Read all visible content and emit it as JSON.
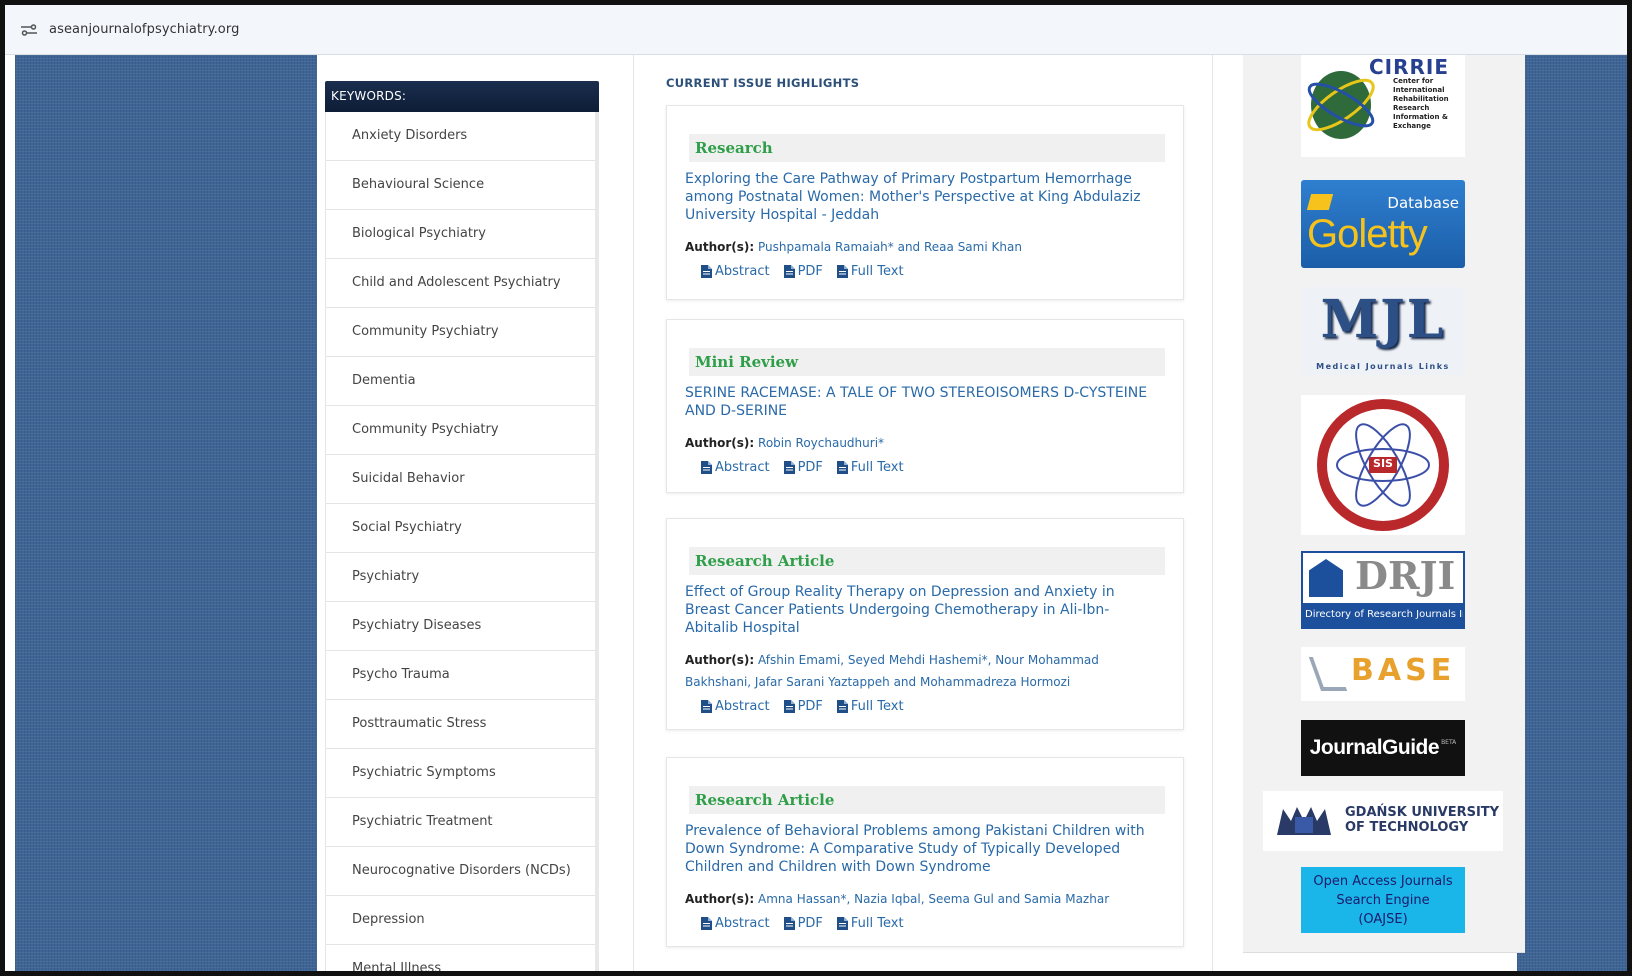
{
  "browser": {
    "url": "aseanjournalofpsychiatry.org"
  },
  "keywords": {
    "header": "KEYWORDS:",
    "items": [
      "Anxiety Disorders",
      "Behavioural Science",
      "Biological Psychiatry",
      "Child and Adolescent Psychiatry",
      "Community Psychiatry",
      "Dementia",
      "Community Psychiatry",
      "Suicidal Behavior",
      "Social Psychiatry",
      "Psychiatry",
      "Psychiatry Diseases",
      "Psycho Trauma",
      "Posttraumatic Stress",
      "Psychiatric Symptoms",
      "Psychiatric Treatment",
      "Neurocognative Disorders (NCDs)",
      "Depression",
      "Mental Illness"
    ]
  },
  "highlights": {
    "title": "CURRENT ISSUE HIGHLIGHTS",
    "author_label": "Author(s):",
    "links": {
      "abstract": "Abstract",
      "pdf": "PDF",
      "fulltext": "Full Text"
    },
    "articles": [
      {
        "type": "Research",
        "title": "Exploring the Care Pathway of Primary Postpartum Hemorrhage among Postnatal Women: Mother's Perspective at King Abdulaziz University Hospital - Jeddah",
        "authors": "Pushpamala Ramaiah* and Reaa Sami Khan"
      },
      {
        "type": "Mini Review",
        "title": "SERINE RACEMASE: A TALE OF TWO STEREOISOMERS D-CYSTEINE AND D-SERINE",
        "authors": "Robin Roychaudhuri*"
      },
      {
        "type": "Research Article",
        "title": "Effect of Group Reality Therapy on Depression and Anxiety in Breast Cancer Patients Undergoing Chemotherapy in Ali-Ibn-Abitalib Hospital",
        "authors": "Afshin Emami, Seyed Mehdi Hashemi*, Nour Mohammad Bakhshani, Jafar Sarani Yaztappeh and Mohammadreza Hormozi"
      },
      {
        "type": "Research Article",
        "title": "Prevalence of Behavioral Problems among Pakistani Children with Down Syndrome: A Comparative Study of Typically Developed Children and Children with Down Syndrome",
        "authors": "Amna Hassan*, Nazia Iqbal, Seema Gul and Samia Mazhar"
      }
    ]
  },
  "logos": {
    "cirrie": {
      "name": "CIRRIE",
      "lines": [
        "Center for",
        "International",
        "Rehabilitation",
        "Research",
        "Information &",
        "Exchange"
      ]
    },
    "goletty": {
      "top": "Database",
      "word": "Goletty"
    },
    "mjl": {
      "word": "MJL",
      "sub": "Medical Journals Links"
    },
    "sis": {
      "text": "SIS"
    },
    "drji": {
      "word": "DRJI",
      "sub": "Directory of Research Journals Indexing"
    },
    "base": {
      "word": "BASE"
    },
    "journalguide": {
      "word": "JournalGuide",
      "beta": "BETA"
    },
    "gdansk": {
      "line1": "GDAŃSK UNIVERSITY",
      "line2": "OF TECHNOLOGY"
    },
    "oajse": {
      "line1": "Open Access Journals",
      "line2": "Search Engine",
      "line3": "(OAJSE)"
    }
  },
  "colors": {
    "link": "#2a6aa8",
    "type_green": "#2e9e48",
    "header_navy": "#13233f",
    "page_bg_blue": "#3e6596"
  }
}
